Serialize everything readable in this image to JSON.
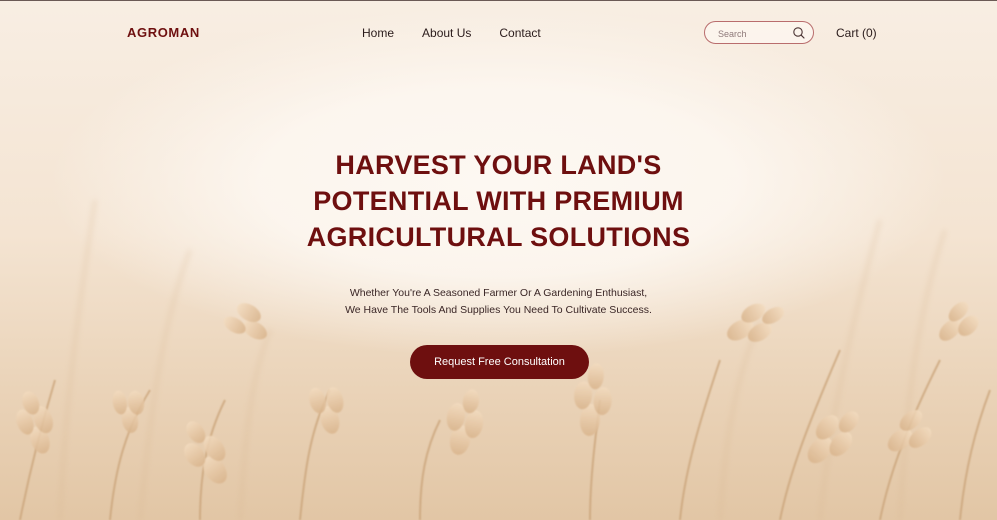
{
  "brand": {
    "name": "AGROMAN"
  },
  "nav": {
    "items": [
      {
        "label": "Home"
      },
      {
        "label": "About Us"
      },
      {
        "label": "Contact"
      }
    ],
    "search": {
      "placeholder": "Search",
      "value": ""
    },
    "cart_label": "Cart (0)"
  },
  "hero": {
    "title_lines": [
      "HARVEST YOUR LAND'S",
      "POTENTIAL WITH PREMIUM",
      "AGRICULTURAL SOLUTIONS"
    ],
    "subtitle_lines": [
      "Whether You're A Seasoned Farmer Or A Gardening Enthusiast,",
      "We Have The Tools And Supplies You Need To Cultivate Success."
    ],
    "cta_label": "Request Free Consultation"
  },
  "colors": {
    "accent": "#6e0f0f",
    "text": "#2a1b1b",
    "search_border": "#b96d6d",
    "background": "#f6ebe0"
  },
  "icons": {
    "search": "search-icon"
  }
}
